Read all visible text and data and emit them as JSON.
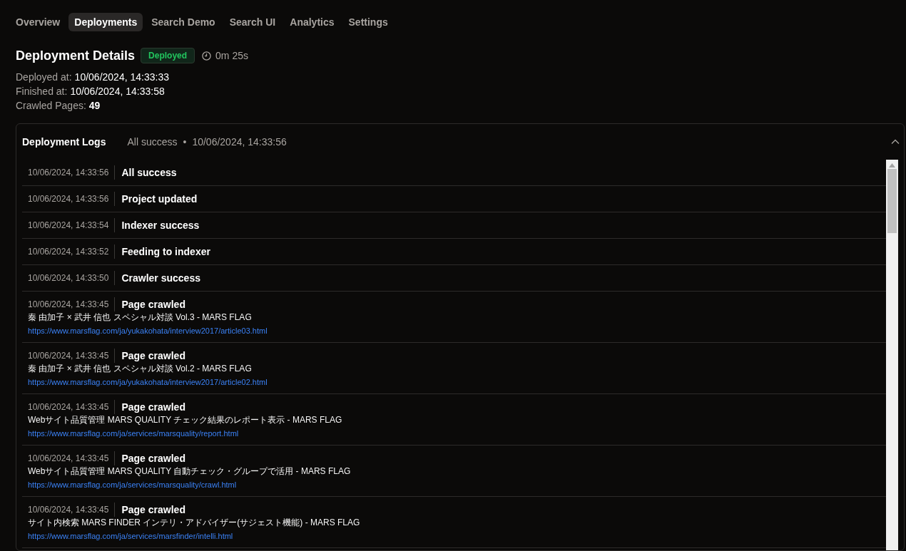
{
  "tabs": [
    {
      "label": "Overview",
      "selected": false
    },
    {
      "label": "Deployments",
      "selected": true
    },
    {
      "label": "Search Demo",
      "selected": false
    },
    {
      "label": "Search UI",
      "selected": false
    },
    {
      "label": "Analytics",
      "selected": false
    },
    {
      "label": "Settings",
      "selected": false
    }
  ],
  "details": {
    "title": "Deployment Details",
    "status": "Deployed",
    "duration": "0m 25s",
    "fields": [
      {
        "label": "Deployed at:",
        "value": "10/06/2024, 14:33:33"
      },
      {
        "label": "Finished at:",
        "value": "10/06/2024, 14:33:58"
      },
      {
        "label": "Crawled Pages:",
        "value": "49"
      }
    ]
  },
  "logs": {
    "title": "Deployment Logs",
    "summary": "All success",
    "separator": "•",
    "summary_time": "10/06/2024, 14:33:56",
    "expanded": true,
    "entries": [
      {
        "time": "10/06/2024, 14:33:56",
        "event": "All success"
      },
      {
        "time": "10/06/2024, 14:33:56",
        "event": "Project updated"
      },
      {
        "time": "10/06/2024, 14:33:54",
        "event": "Indexer success"
      },
      {
        "time": "10/06/2024, 14:33:52",
        "event": "Feeding to indexer"
      },
      {
        "time": "10/06/2024, 14:33:50",
        "event": "Crawler success"
      },
      {
        "time": "10/06/2024, 14:33:45",
        "event": "Page crawled",
        "page_title": "秦 由加子 × 武井 信也 スペシャル対談 Vol.3 - MARS FLAG",
        "url": "https://www.marsflag.com/ja/yukakohata/interview2017/article03.html"
      },
      {
        "time": "10/06/2024, 14:33:45",
        "event": "Page crawled",
        "page_title": "秦 由加子 × 武井 信也 スペシャル対談 Vol.2 - MARS FLAG",
        "url": "https://www.marsflag.com/ja/yukakohata/interview2017/article02.html"
      },
      {
        "time": "10/06/2024, 14:33:45",
        "event": "Page crawled",
        "page_title": "Webサイト品質管理 MARS QUALITY チェック結果のレポート表示 - MARS FLAG",
        "url": "https://www.marsflag.com/ja/services/marsquality/report.html"
      },
      {
        "time": "10/06/2024, 14:33:45",
        "event": "Page crawled",
        "page_title": "Webサイト品質管理 MARS QUALITY 自動チェック・グループで活用 - MARS FLAG",
        "url": "https://www.marsflag.com/ja/services/marsquality/crawl.html"
      },
      {
        "time": "10/06/2024, 14:33:45",
        "event": "Page crawled",
        "page_title": "サイト内検索 MARS FINDER インテリ・アドバイザー(サジェスト機能) - MARS FLAG",
        "url": "https://www.marsflag.com/ja/services/marsfinder/intelli.html"
      }
    ]
  }
}
